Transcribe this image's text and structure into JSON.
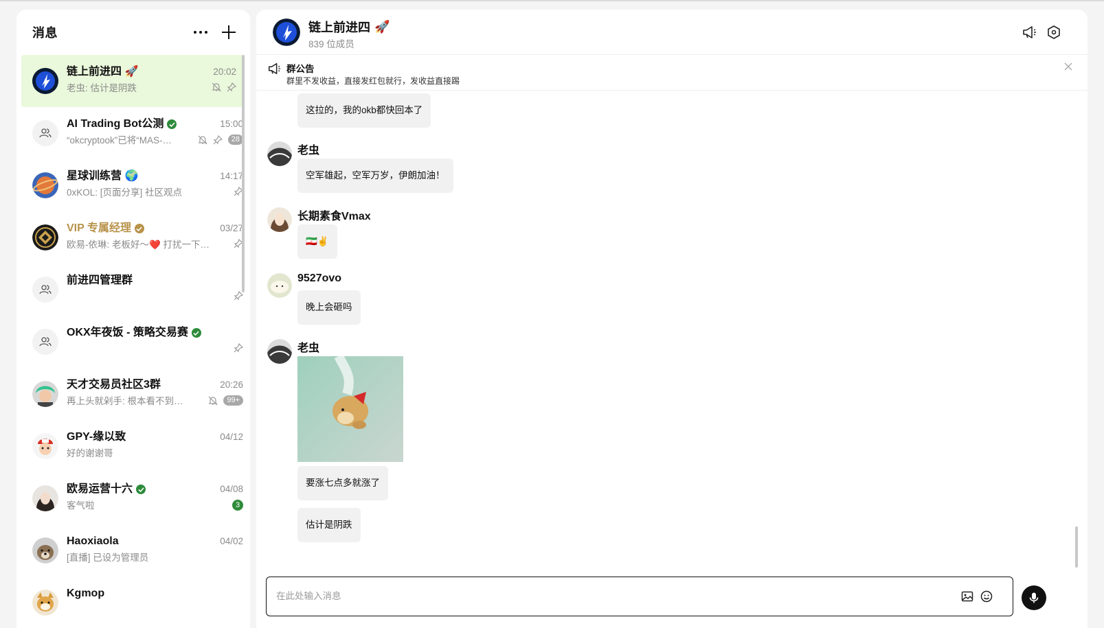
{
  "sidebar": {
    "title": "消息",
    "conversations": [
      {
        "name": "链上前进四 🚀",
        "preview": "老虫: 估计是阴跌",
        "time": "20:02",
        "muted": true,
        "pinned": true,
        "active": true,
        "avatar": "rocket-logo"
      },
      {
        "name": "AI Trading Bot公测",
        "preview": "“okcryptook”已将“MAS-…",
        "time": "15:00",
        "muted": true,
        "pinned": true,
        "badge": "28",
        "verified": true,
        "avatar": "group-icon"
      },
      {
        "name": "星球训练营 🌍",
        "preview": "0xKOL: [页面分享] 社区观点",
        "time": "14:17",
        "pinned": true,
        "avatar": "planet"
      },
      {
        "name": "VIP 专属经理",
        "preview": "欧易-依琳: 老板好～❤️ 打扰一下…",
        "time": "03/27",
        "pinned": true,
        "verified_gold": true,
        "avatar": "vip-logo"
      },
      {
        "name": "前进四管理群",
        "preview": "",
        "time": "",
        "pinned": true,
        "avatar": "group-icon"
      },
      {
        "name": "OKX年夜饭 - 策略交易赛",
        "preview": "",
        "time": "",
        "pinned": true,
        "verified": true,
        "avatar": "group-icon"
      },
      {
        "name": "天才交易员社区3群",
        "preview": "再上头就剁手: 根本看不到价…",
        "time": "20:26",
        "muted": true,
        "badge": "99+",
        "avatar": "green-hair"
      },
      {
        "name": "GPY-缘以致",
        "preview": "好的谢谢哥",
        "time": "04/12",
        "avatar": "cartoon-cap"
      },
      {
        "name": "欧易运营十六",
        "preview": "客气啦",
        "time": "04/08",
        "verified": true,
        "badge_green": "3",
        "avatar": "woman"
      },
      {
        "name": "Haoxiaola",
        "preview": "[直播] 已设为管理员",
        "time": "04/02",
        "avatar": "dog"
      },
      {
        "name": "Kgmop",
        "preview": "",
        "time": "",
        "avatar": "shiba"
      }
    ]
  },
  "chat": {
    "title": "链上前进四",
    "title_emoji": "🚀",
    "member_count": "839 位成员",
    "announcement_title": "群公告",
    "announcement_text": "群里不发收益，直接发红包就行，发收益直接踢",
    "messages": [
      {
        "text": "这拉的，我的okb都快回本了"
      },
      {
        "sender": "老虫",
        "text": "空军雄起，空军万岁，伊朗加油！"
      },
      {
        "sender": "长期素食Vmax",
        "text": "🇮🇷✌️"
      },
      {
        "sender": "9527ovo",
        "text": "晚上会砸吗"
      },
      {
        "sender": "老虫",
        "sticker": "dog-sticker",
        "texts": [
          "要涨七点多就涨了",
          "估计是阴跌"
        ]
      }
    ],
    "composer_placeholder": "在此处输入消息"
  },
  "colors": {
    "accent": "#2e8b3a",
    "active_bg": "#eaf8db",
    "gold": "#b8924a"
  }
}
